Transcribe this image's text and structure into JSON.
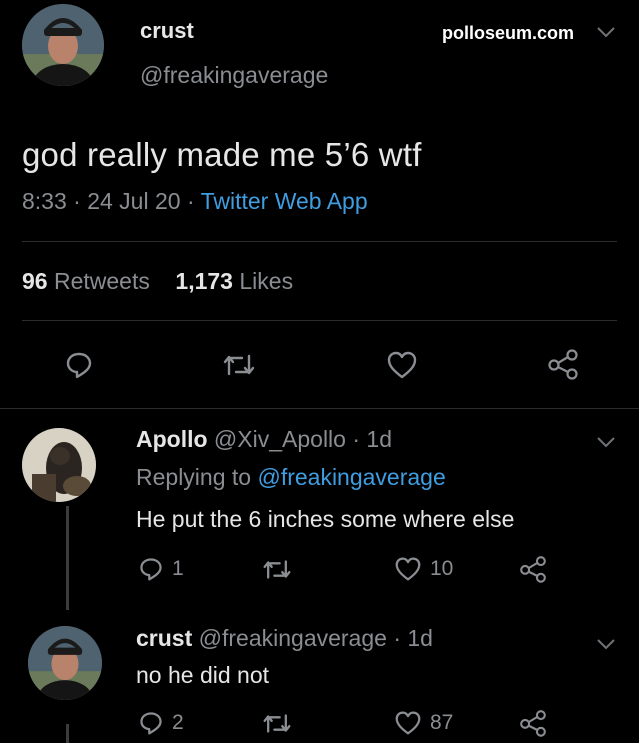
{
  "watermark": "polloseum.com",
  "main_tweet": {
    "display_name": "crust",
    "handle": "@freakingaverage",
    "text": "god really made me 5’6 wtf",
    "time": "8:33 · 24 Jul 20 · ",
    "app": "Twitter Web App",
    "retweets_count": "96",
    "retweets_label": " Retweets",
    "likes_count": "1,173",
    "likes_label": " Likes"
  },
  "replies": [
    {
      "display_name": "Apollo",
      "handle_time": " @Xiv_Apollo · 1d",
      "replying_prefix": "Replying to ",
      "replying_to": "@freakingaverage",
      "text": "He put the 6 inches some where else",
      "reply_count": "1",
      "retweet_count": "",
      "like_count": "10"
    },
    {
      "display_name": "crust",
      "handle_time": " @freakingaverage · 1d",
      "text": "no he did not",
      "reply_count": "2",
      "retweet_count": "",
      "like_count": "87"
    }
  ],
  "icons": {
    "reply": "reply-icon",
    "retweet": "retweet-icon",
    "like": "heart-icon",
    "share": "share-icon",
    "caret": "chevron-down-icon"
  },
  "colors": {
    "background": "#000000",
    "link": "#3f9de0",
    "secondary_text": "#8a8d91",
    "primary_text": "#e6e6e6"
  }
}
